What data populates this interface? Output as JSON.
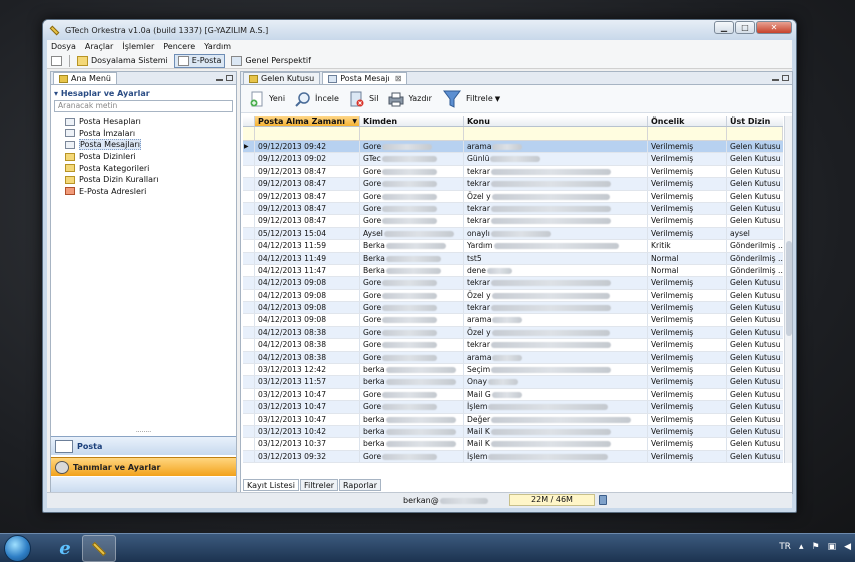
{
  "window": {
    "title": "GTech Orkestra v1.0a (build 1337) [G-YAZILIM A.S.]",
    "min_glyph": "▁",
    "max_glyph": "□",
    "close_glyph": "✕"
  },
  "menu": [
    "Dosya",
    "Araçlar",
    "İşlemler",
    "Pencere",
    "Yardım"
  ],
  "perspectives": {
    "items": [
      "Dosyalama Sistemi",
      "E-Posta",
      "Genel Perspektif"
    ],
    "active": "E-Posta"
  },
  "left_panel": {
    "tab": "Ana Menü",
    "section": "Hesaplar ve Ayarlar",
    "search_placeholder": "Aranacak metin",
    "tree": [
      {
        "label": "Posta Hesapları",
        "icon": "mailbox-icon"
      },
      {
        "label": "Posta İmzaları",
        "icon": "signature-icon"
      },
      {
        "label": "Posta Mesajları",
        "icon": "message-icon",
        "selected": true
      },
      {
        "label": "Posta Dizinleri",
        "icon": "folder-icon"
      },
      {
        "label": "Posta Kategorileri",
        "icon": "category-folder-icon"
      },
      {
        "label": "Posta Dizin Kuralları",
        "icon": "rule-folder-icon"
      },
      {
        "label": "E-Posta Adresleri",
        "icon": "address-icon"
      }
    ],
    "splitter": "........",
    "nav_posta": "Posta",
    "nav_tanim": "Tanımlar ve Ayarlar"
  },
  "right_panel": {
    "tabs": [
      "Gelen Kutusu",
      "Posta Mesajı"
    ],
    "active_tab": "Posta Mesajı",
    "toolbar": {
      "new": "Yeni",
      "inspect": "İncele",
      "delete": "Sil",
      "print": "Yazdır",
      "filter": "Filtrele"
    },
    "columns": [
      "Posta Alma Zamanı",
      "Kimden",
      "Konu",
      "Öncelik",
      "Üst Dizin"
    ],
    "rows": [
      {
        "date": "09/12/2013 09:42",
        "from": "Gore",
        "fb": 50,
        "subj": "arama",
        "sb": 30,
        "pri": "Verilmemiş",
        "dir": "Gelen Kutusu",
        "sel": true
      },
      {
        "date": "09/12/2013 09:02",
        "from": "GTec",
        "fb": 55,
        "subj": "Günlü",
        "sb": 50,
        "pri": "Verilmemiş",
        "dir": "Gelen Kutusu"
      },
      {
        "date": "09/12/2013 08:47",
        "from": "Gore",
        "fb": 55,
        "subj": "tekrar",
        "sb": 120,
        "pri": "Verilmemiş",
        "dir": "Gelen Kutusu"
      },
      {
        "date": "09/12/2013 08:47",
        "from": "Gore",
        "fb": 55,
        "subj": "tekrar",
        "sb": 120,
        "pri": "Verilmemiş",
        "dir": "Gelen Kutusu"
      },
      {
        "date": "09/12/2013 08:47",
        "from": "Gore",
        "fb": 55,
        "subj": "Özel y",
        "sb": 118,
        "pri": "Verilmemiş",
        "dir": "Gelen Kutusu"
      },
      {
        "date": "09/12/2013 08:47",
        "from": "Gore",
        "fb": 55,
        "subj": "tekrar",
        "sb": 120,
        "pri": "Verilmemiş",
        "dir": "Gelen Kutusu"
      },
      {
        "date": "09/12/2013 08:47",
        "from": "Gore",
        "fb": 55,
        "subj": "tekrar",
        "sb": 120,
        "pri": "Verilmemiş",
        "dir": "Gelen Kutusu"
      },
      {
        "date": "05/12/2013 15:04",
        "from": "Aysel",
        "fb": 70,
        "subj": "onaylı",
        "sb": 60,
        "pri": "Verilmemiş",
        "dir": "aysel"
      },
      {
        "date": "04/12/2013 11:59",
        "from": "Berka",
        "fb": 60,
        "subj": "Yardım",
        "sb": 125,
        "pri": "Kritik",
        "dir": "Gönderilmiş ..."
      },
      {
        "date": "04/12/2013 11:49",
        "from": "Berka",
        "fb": 55,
        "subj": "tst5",
        "sb": 0,
        "pri": "Normal",
        "dir": "Gönderilmiş ..."
      },
      {
        "date": "04/12/2013 11:47",
        "from": "Berka",
        "fb": 55,
        "subj": "dene",
        "sb": 25,
        "pri": "Normal",
        "dir": "Gönderilmiş ..."
      },
      {
        "date": "04/12/2013 09:08",
        "from": "Gore",
        "fb": 55,
        "subj": "tekrar",
        "sb": 120,
        "pri": "Verilmemiş",
        "dir": "Gelen Kutusu"
      },
      {
        "date": "04/12/2013 09:08",
        "from": "Gore",
        "fb": 55,
        "subj": "Özel y",
        "sb": 118,
        "pri": "Verilmemiş",
        "dir": "Gelen Kutusu"
      },
      {
        "date": "04/12/2013 09:08",
        "from": "Gore",
        "fb": 55,
        "subj": "tekrar",
        "sb": 120,
        "pri": "Verilmemiş",
        "dir": "Gelen Kutusu"
      },
      {
        "date": "04/12/2013 09:08",
        "from": "Gore",
        "fb": 55,
        "subj": "arama",
        "sb": 30,
        "pri": "Verilmemiş",
        "dir": "Gelen Kutusu"
      },
      {
        "date": "04/12/2013 08:38",
        "from": "Gore",
        "fb": 55,
        "subj": "Özel y",
        "sb": 118,
        "pri": "Verilmemiş",
        "dir": "Gelen Kutusu"
      },
      {
        "date": "04/12/2013 08:38",
        "from": "Gore",
        "fb": 55,
        "subj": "tekrar",
        "sb": 120,
        "pri": "Verilmemiş",
        "dir": "Gelen Kutusu"
      },
      {
        "date": "04/12/2013 08:38",
        "from": "Gore",
        "fb": 55,
        "subj": "arama",
        "sb": 30,
        "pri": "Verilmemiş",
        "dir": "Gelen Kutusu"
      },
      {
        "date": "03/12/2013 12:42",
        "from": "berka",
        "fb": 70,
        "subj": "Seçim",
        "sb": 120,
        "pri": "Verilmemiş",
        "dir": "Gelen Kutusu"
      },
      {
        "date": "03/12/2013 11:57",
        "from": "berka",
        "fb": 70,
        "subj": "Onay",
        "sb": 30,
        "pri": "Verilmemiş",
        "dir": "Gelen Kutusu"
      },
      {
        "date": "03/12/2013 10:47",
        "from": "Gore",
        "fb": 55,
        "subj": "Mail G",
        "sb": 30,
        "pri": "Verilmemiş",
        "dir": "Gelen Kutusu"
      },
      {
        "date": "03/12/2013 10:47",
        "from": "Gore",
        "fb": 55,
        "subj": "İşlem",
        "sb": 120,
        "pri": "Verilmemiş",
        "dir": "Gelen Kutusu"
      },
      {
        "date": "03/12/2013 10:47",
        "from": "berka",
        "fb": 70,
        "subj": "Değer",
        "sb": 140,
        "pri": "Verilmemiş",
        "dir": "Gelen Kutusu"
      },
      {
        "date": "03/12/2013 10:42",
        "from": "berka",
        "fb": 70,
        "subj": "Mail K",
        "sb": 120,
        "pri": "Verilmemiş",
        "dir": "Gelen Kutusu"
      },
      {
        "date": "03/12/2013 10:37",
        "from": "berka",
        "fb": 70,
        "subj": "Mail K",
        "sb": 120,
        "pri": "Verilmemiş",
        "dir": "Gelen Kutusu"
      },
      {
        "date": "03/12/2013 09:32",
        "from": "Gore",
        "fb": 55,
        "subj": "İşlem",
        "sb": 120,
        "pri": "Verilmemiş",
        "dir": "Gelen Kutusu"
      }
    ],
    "bottom_tabs": [
      "Kayıt Listesi",
      "Filtreler",
      "Raporlar"
    ]
  },
  "status": {
    "user": "berkan@",
    "memory": "22M / 46M"
  },
  "taskbar": {
    "lang": "TR"
  }
}
